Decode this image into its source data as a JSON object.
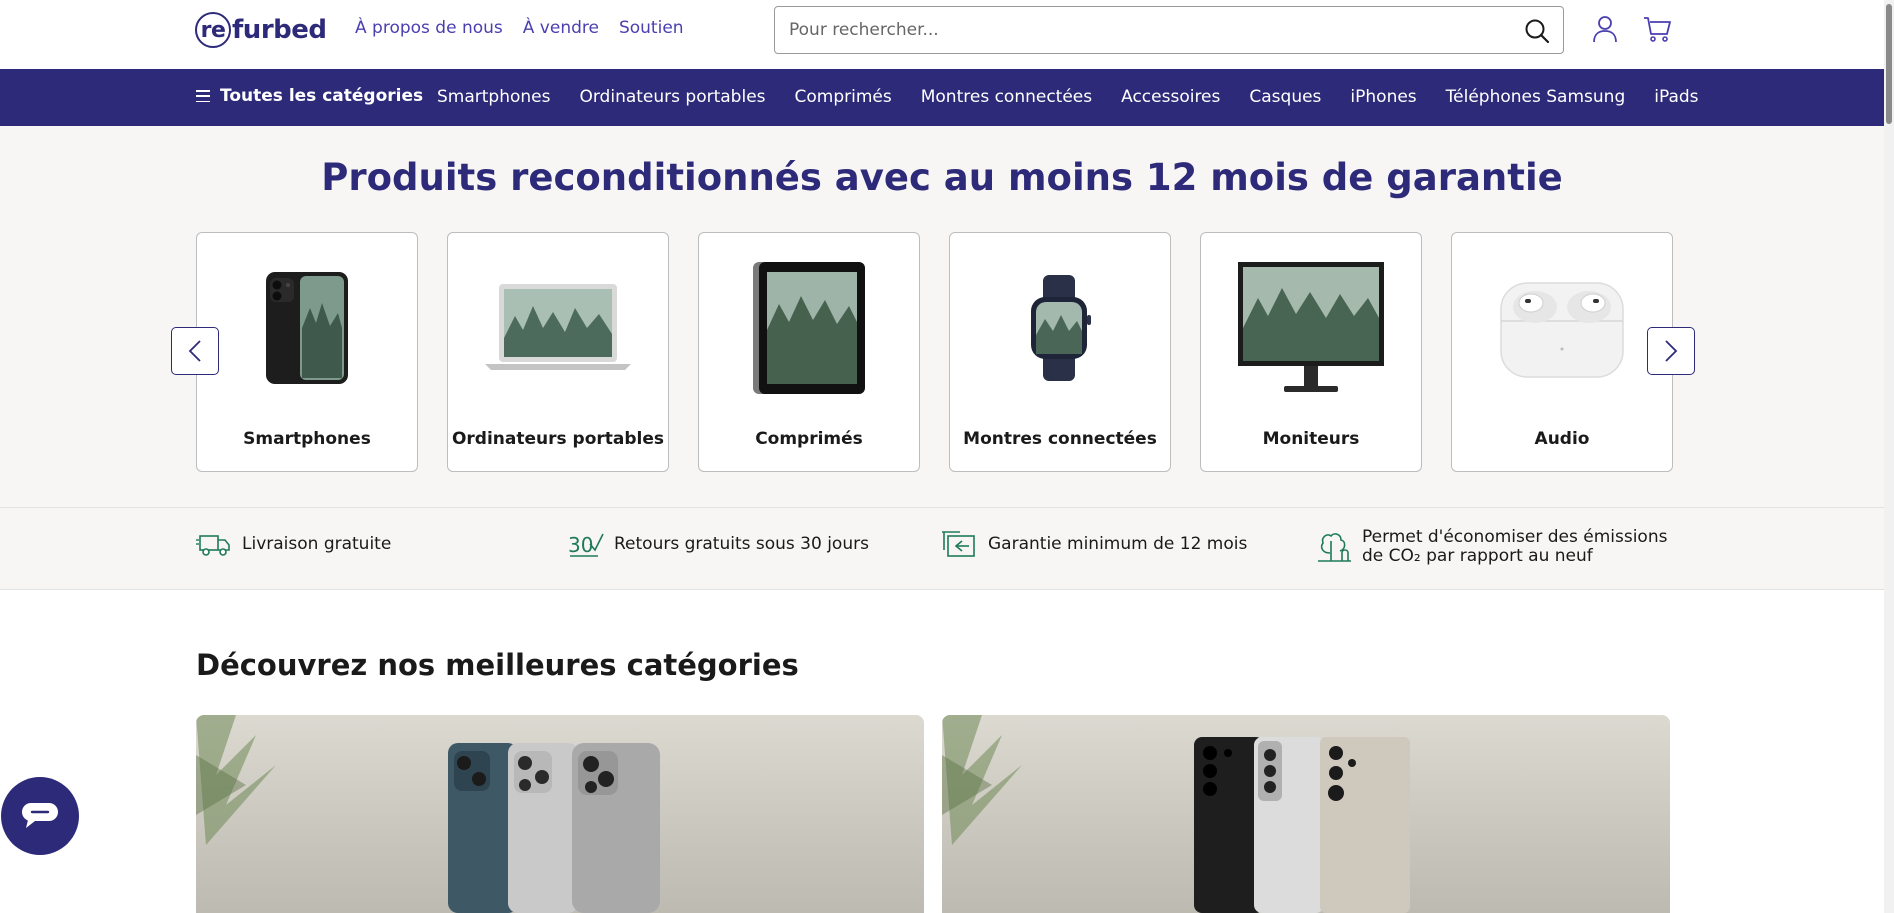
{
  "header": {
    "logo_prefix": "re",
    "logo_suffix": "furbed",
    "links": [
      "À propos de nous",
      "À vendre",
      "Soutien"
    ],
    "search_placeholder": "Pour rechercher..."
  },
  "nav": {
    "all_categories": "Toutes les catégories",
    "items": [
      "Smartphones",
      "Ordinateurs portables",
      "Comprimés",
      "Montres connectées",
      "Accessoires",
      "Casques",
      "iPhones",
      "Téléphones Samsung",
      "iPads"
    ]
  },
  "hero": {
    "title": "Produits reconditionnés avec au moins 12 mois de garantie",
    "cards": [
      {
        "label": "Smartphones",
        "icon": "smartphone-image"
      },
      {
        "label": "Ordinateurs portables",
        "icon": "laptop-image"
      },
      {
        "label": "Comprimés",
        "icon": "tablet-image"
      },
      {
        "label": "Montres connectées",
        "icon": "smartwatch-image"
      },
      {
        "label": "Moniteurs",
        "icon": "monitor-image"
      },
      {
        "label": "Audio",
        "icon": "earbuds-image"
      }
    ]
  },
  "benefits": [
    {
      "text": "Livraison gratuite",
      "icon": "truck-icon"
    },
    {
      "text": "Retours gratuits sous 30 jours",
      "icon": "30-days-icon"
    },
    {
      "text": "Garantie minimum de 12 mois",
      "icon": "warranty-icon"
    },
    {
      "text_line1": "Permet d'économiser des émissions",
      "text_line2": "de CO₂ par rapport au neuf",
      "icon": "tree-icon"
    }
  ],
  "best": {
    "title": "Découvrez nos meilleures catégories",
    "banners": [
      "iphones-banner-image",
      "samsung-banner-image"
    ]
  },
  "colors": {
    "brand": "#2e2a7a",
    "link": "#4a3fb0",
    "accent_green": "#1f7a5a"
  }
}
